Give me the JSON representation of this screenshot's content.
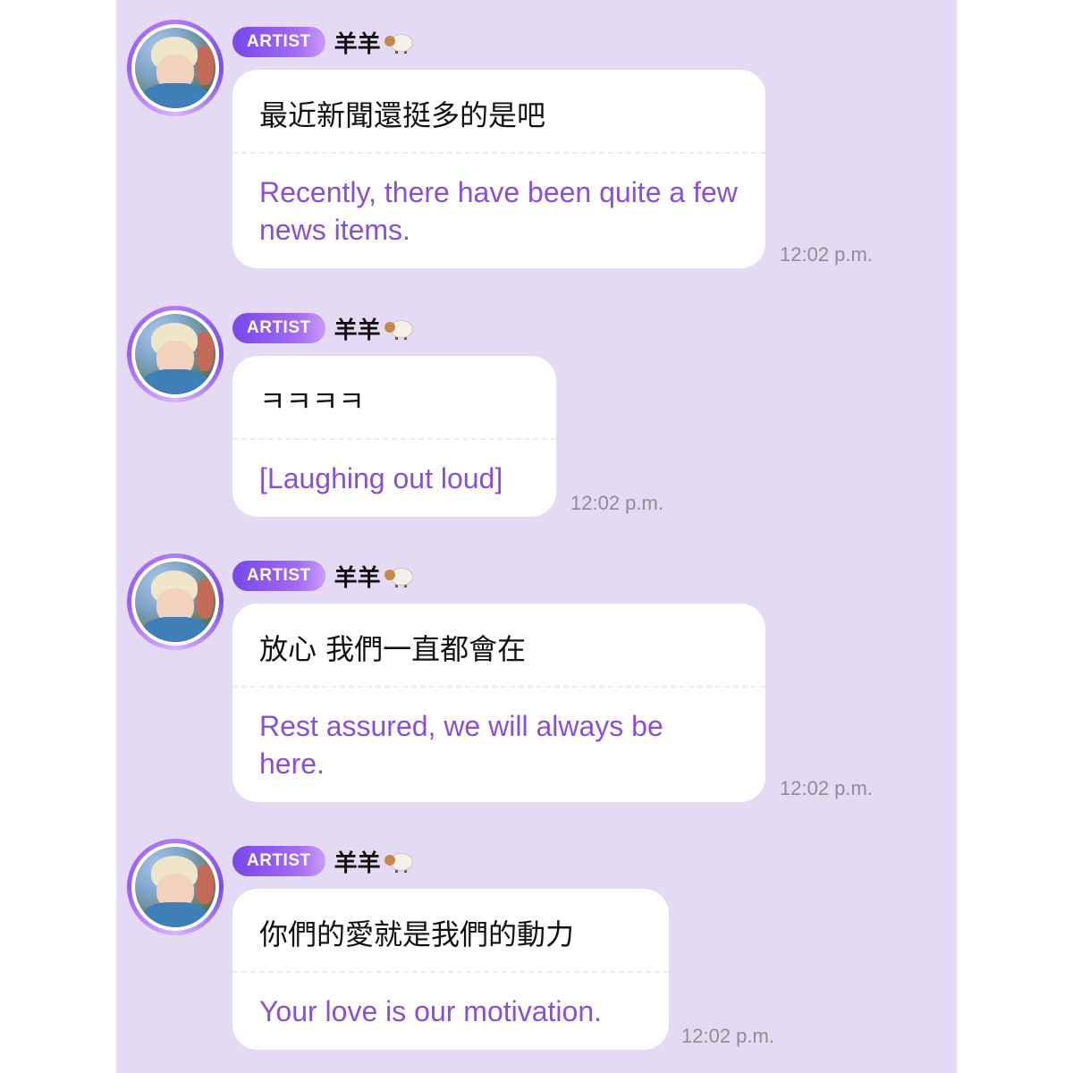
{
  "badge_label": "ARTIST",
  "username": "羊羊",
  "messages": [
    {
      "original": "最近新聞還挺多的是吧",
      "translation": "Recently, there have been quite a few news items.",
      "time": "12:02 p.m."
    },
    {
      "original": "ㅋㅋㅋㅋ",
      "translation": "[Laughing out loud]",
      "time": "12:02 p.m."
    },
    {
      "original": "放心 我們一直都會在",
      "translation": "Rest assured, we will always be here.",
      "time": "12:02 p.m."
    },
    {
      "original": "你們的愛就是我們的動力",
      "translation": "Your love is our motivation.",
      "time": "12:02 p.m."
    }
  ],
  "icons": {
    "username_emoji": "sheep-icon"
  },
  "colors": {
    "background": "#e4daf3",
    "translation_text": "#8a4fd8",
    "badge_start": "#7648e8",
    "badge_end": "#c89cf7",
    "timestamp": "#8e8e93"
  }
}
